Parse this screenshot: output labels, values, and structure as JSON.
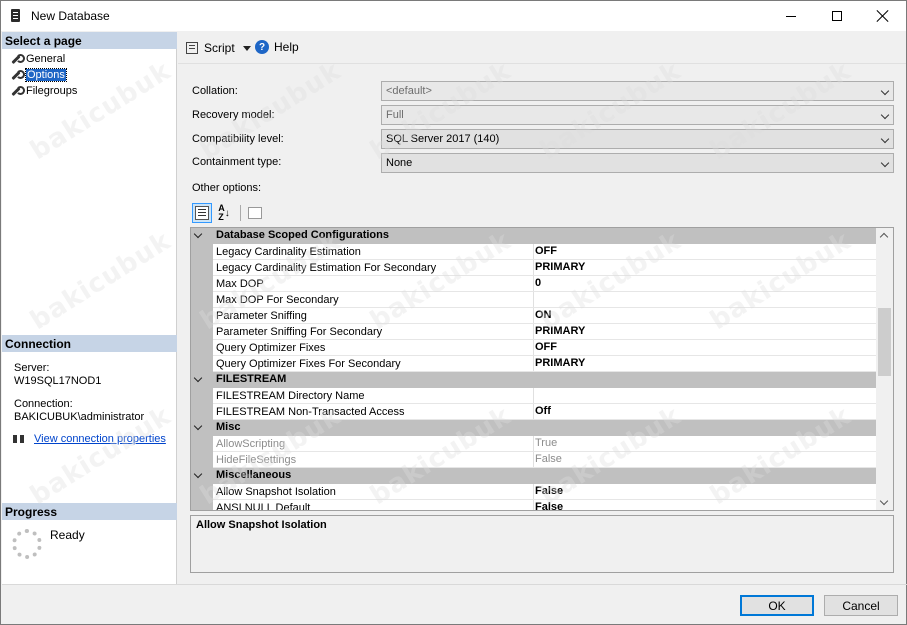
{
  "window": {
    "title": "New Database"
  },
  "left": {
    "select_page_header": "Select a page",
    "pages": [
      {
        "label": "General",
        "selected": false
      },
      {
        "label": "Options",
        "selected": true
      },
      {
        "label": "Filegroups",
        "selected": false
      }
    ],
    "connection_header": "Connection",
    "server_label": "Server:",
    "server_value": "W19SQL17NOD1",
    "connection_label": "Connection:",
    "connection_value": "BAKICUBUK\\administrator",
    "view_connection_link": "View connection properties",
    "progress_header": "Progress",
    "progress_status": "Ready"
  },
  "toolbar": {
    "script_label": "Script",
    "help_label": "Help"
  },
  "form": {
    "collation_label": "Collation:",
    "collation_value": "<default>",
    "recovery_label": "Recovery model:",
    "recovery_value": "Full",
    "compat_label": "Compatibility level:",
    "compat_value": "SQL Server 2017 (140)",
    "containment_label": "Containment type:",
    "containment_value": "None",
    "other_options_label": "Other options:"
  },
  "grid": {
    "rows": [
      {
        "type": "category",
        "name": "Database Scoped Configurations"
      },
      {
        "type": "prop",
        "name": "Legacy Cardinality Estimation",
        "value": "OFF"
      },
      {
        "type": "prop",
        "name": "Legacy Cardinality Estimation For Secondary",
        "value": "PRIMARY"
      },
      {
        "type": "prop",
        "name": "Max DOP",
        "value": "0"
      },
      {
        "type": "prop",
        "name": "Max DOP For Secondary",
        "value": ""
      },
      {
        "type": "prop",
        "name": "Parameter Sniffing",
        "value": "ON"
      },
      {
        "type": "prop",
        "name": "Parameter Sniffing For Secondary",
        "value": "PRIMARY"
      },
      {
        "type": "prop",
        "name": "Query Optimizer Fixes",
        "value": "OFF"
      },
      {
        "type": "prop",
        "name": "Query Optimizer Fixes For Secondary",
        "value": "PRIMARY"
      },
      {
        "type": "category",
        "name": "FILESTREAM"
      },
      {
        "type": "prop",
        "name": "FILESTREAM Directory Name",
        "value": ""
      },
      {
        "type": "prop",
        "name": "FILESTREAM Non-Transacted Access",
        "value": "Off"
      },
      {
        "type": "category",
        "name": "Misc"
      },
      {
        "type": "prop",
        "name": "AllowScripting",
        "value": "True",
        "dim": true
      },
      {
        "type": "prop",
        "name": "HideFileSettings",
        "value": "False",
        "dim": true
      },
      {
        "type": "category",
        "name": "Miscellaneous"
      },
      {
        "type": "prop",
        "name": "Allow Snapshot Isolation",
        "value": "False"
      },
      {
        "type": "prop",
        "name": "ANSI NULL Default",
        "value": "False"
      }
    ]
  },
  "description": {
    "title": "Allow Snapshot Isolation"
  },
  "buttons": {
    "ok": "OK",
    "cancel": "Cancel"
  },
  "watermark": "bakicubuk"
}
